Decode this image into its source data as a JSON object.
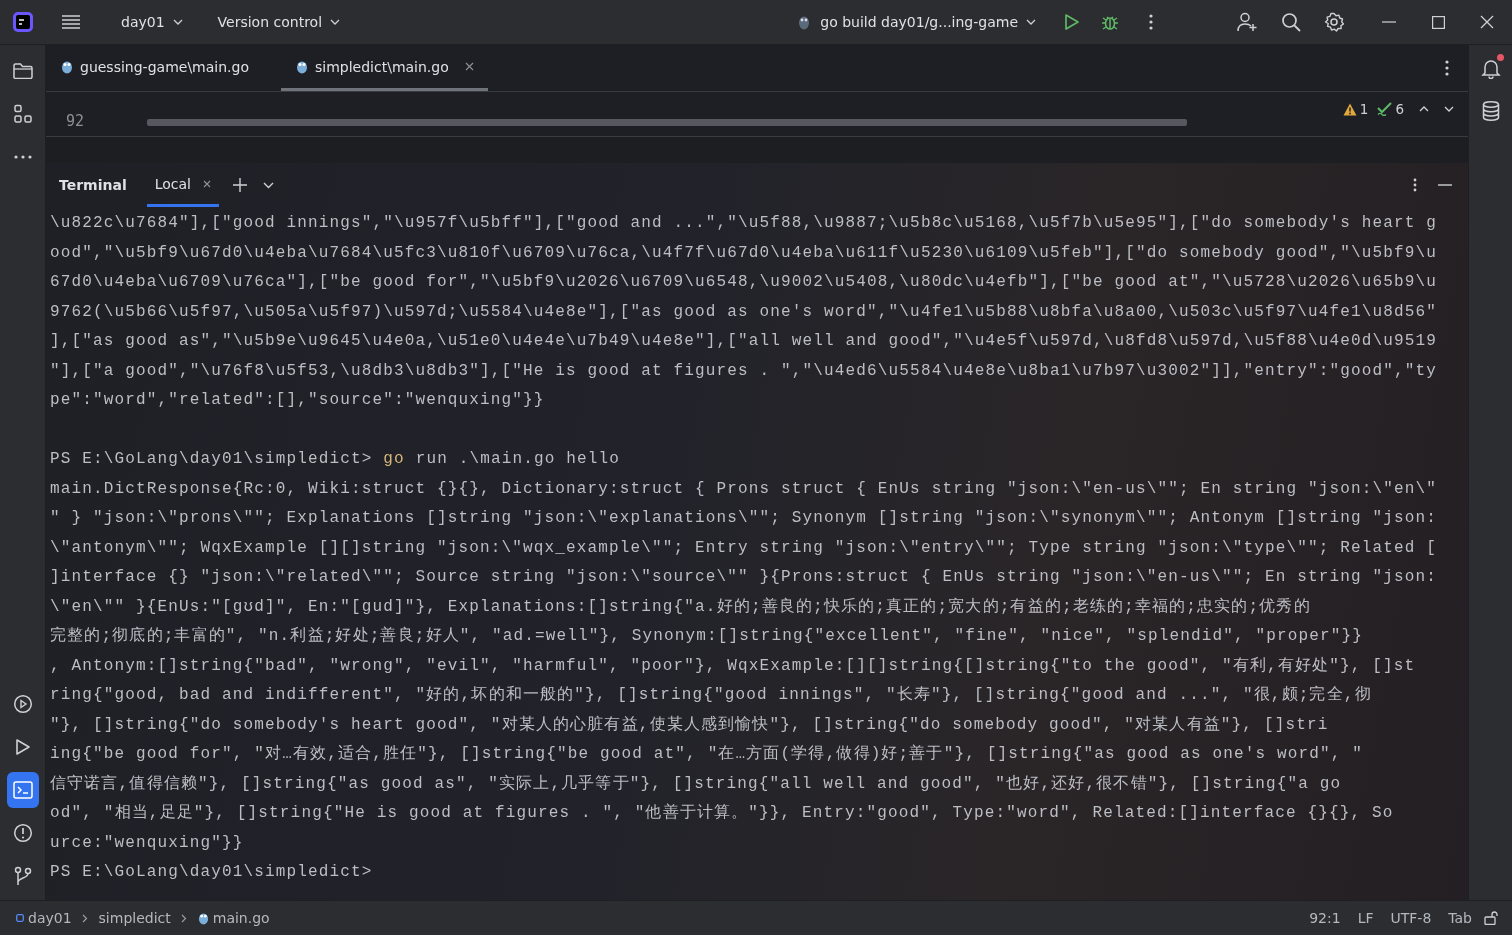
{
  "title_bar": {
    "project": "day01",
    "vcs": "Version control",
    "run_config": "go build day01/g...ing-game"
  },
  "tool_windows": [
    {
      "kind": "folder",
      "selected": false
    },
    {
      "kind": "structure",
      "selected": false
    },
    {
      "kind": "more",
      "selected": false
    },
    {
      "kind": "services",
      "selected": false
    },
    {
      "kind": "run",
      "selected": false
    },
    {
      "kind": "terminal",
      "selected": true
    },
    {
      "kind": "problems",
      "selected": false
    },
    {
      "kind": "git",
      "selected": false
    }
  ],
  "notifications": {
    "unread": true
  },
  "editor_tabs": [
    {
      "label": "guessing-game\\main.go",
      "selected": false
    },
    {
      "label": "simpledict\\main.go",
      "selected": true
    }
  ],
  "editor": {
    "line_number": "92",
    "warnings": "1",
    "checks": "6"
  },
  "terminal": {
    "title": "Terminal",
    "tabs": [
      {
        "label": "Local",
        "selected": true
      }
    ],
    "lines": [
      {
        "kind": "output",
        "text": "\\u822c\\u7684\"],[\"good innings\",\"\\u957f\\u5bff\"],[\"good and ...\",\"\\u5f88,\\u9887;\\u5b8c\\u5168,\\u5f7b\\u5e95\"],[\"do somebody's heart g"
      },
      {
        "kind": "output",
        "text": "ood\",\"\\u5bf9\\u67d0\\u4eba\\u7684\\u5fc3\\u810f\\u6709\\u76ca,\\u4f7f\\u67d0\\u4eba\\u611f\\u5230\\u6109\\u5feb\"],[\"do somebody good\",\"\\u5bf9\\u"
      },
      {
        "kind": "output",
        "text": "67d0\\u4eba\\u6709\\u76ca\"],[\"be good for\",\"\\u5bf9\\u2026\\u6709\\u6548,\\u9002\\u5408,\\u80dc\\u4efb\"],[\"be good at\",\"\\u5728\\u2026\\u65b9\\u"
      },
      {
        "kind": "output",
        "text": "9762(\\u5b66\\u5f97,\\u505a\\u5f97)\\u597d;\\u5584\\u4e8e\"],[\"as good as one's word\",\"\\u4fe1\\u5b88\\u8bfa\\u8a00,\\u503c\\u5f97\\u4fe1\\u8d56\""
      },
      {
        "kind": "output",
        "text": "],[\"as good as\",\"\\u5b9e\\u9645\\u4e0a,\\u51e0\\u4e4e\\u7b49\\u4e8e\"],[\"all well and good\",\"\\u4e5f\\u597d,\\u8fd8\\u597d,\\u5f88\\u4e0d\\u9519"
      },
      {
        "kind": "output",
        "text": "\"],[\"a good\",\"\\u76f8\\u5f53,\\u8db3\\u8db3\"],[\"He is good at figures . \",\"\\u4ed6\\u5584\\u4e8e\\u8ba1\\u7b97\\u3002\"]],\"entry\":\"good\",\"ty"
      },
      {
        "kind": "output",
        "text": "pe\":\"word\",\"related\":[],\"source\":\"wenquxing\"}}"
      },
      {
        "kind": "command",
        "prompt": "PS E:\\GoLang\\day01\\simpledict>",
        "program": "go",
        "args": "run .\\main.go hello"
      },
      {
        "kind": "output",
        "text": "main.DictResponse{Rc:0, Wiki:struct {}{}, Dictionary:struct { Prons struct { EnUs string \"json:\\\"en-us\\\"\"; En string \"json:\\\"en\\\""
      },
      {
        "kind": "output",
        "text": "\" } \"json:\\\"prons\\\"\"; Explanations []string \"json:\\\"explanations\\\"\"; Synonym []string \"json:\\\"synonym\\\"\"; Antonym []string \"json:"
      },
      {
        "kind": "output",
        "text": "\\\"antonym\\\"\"; WqxExample [][]string \"json:\\\"wqx_example\\\"\"; Entry string \"json:\\\"entry\\\"\"; Type string \"json:\\\"type\\\"\"; Related ["
      },
      {
        "kind": "output",
        "text": "]interface {} \"json:\\\"related\\\"\"; Source string \"json:\\\"source\\\"\" }{Prons:struct { EnUs string \"json:\\\"en-us\\\"\"; En string \"json:"
      },
      {
        "kind": "output",
        "text": "\\\"en\\\"\" }{EnUs:\"[gʊd]\", En:\"[gud]\"}, Explanations:[]string{\"a.好的;善良的;快乐的;真正的;宽大的;有益的;老练的;幸福的;忠实的;优秀的"
      },
      {
        "kind": "output",
        "text": "完整的;彻底的;丰富的\", \"n.利益;好处;善良;好人\", \"ad.=well\"}, Synonym:[]string{\"excellent\", \"fine\", \"nice\", \"splendid\", \"proper\"}}"
      },
      {
        "kind": "output",
        "text": ", Antonym:[]string{\"bad\", \"wrong\", \"evil\", \"harmful\", \"poor\"}, WqxExample:[][]string{[]string{\"to the good\", \"有利,有好处\"}, []st"
      },
      {
        "kind": "output",
        "text": "ring{\"good, bad and indifferent\", \"好的,坏的和一般的\"}, []string{\"good innings\", \"长寿\"}, []string{\"good and ...\", \"很,颇;完全,彻"
      },
      {
        "kind": "output",
        "text": "\"}, []string{\"do somebody's heart good\", \"对某人的心脏有益,使某人感到愉快\"}, []string{\"do somebody good\", \"对某人有益\"}, []stri"
      },
      {
        "kind": "output",
        "text": "ing{\"be good for\", \"对…有效,适合,胜任\"}, []string{\"be good at\", \"在…方面(学得,做得)好;善于\"}, []string{\"as good as one's word\", \""
      },
      {
        "kind": "output",
        "text": "信守诺言,值得信赖\"}, []string{\"as good as\", \"实际上,几乎等于\"}, []string{\"all well and good\", \"也好,还好,很不错\"}, []string{\"a go"
      },
      {
        "kind": "output",
        "text": "od\", \"相当,足足\"}, []string{\"He is good at figures . \", \"他善于计算。\"}}, Entry:\"good\", Type:\"word\", Related:[]interface {}{}, So"
      },
      {
        "kind": "output",
        "text": "urce:\"wenquxing\"}}"
      },
      {
        "kind": "prompt",
        "prompt": "PS E:\\GoLang\\day01\\simpledict>"
      }
    ]
  },
  "status_bar": {
    "breadcrumbs": [
      "day01",
      "simpledict",
      "main.go"
    ],
    "position": "92:1",
    "line_ending": "LF",
    "encoding": "UTF-8",
    "indent": "Tab"
  }
}
